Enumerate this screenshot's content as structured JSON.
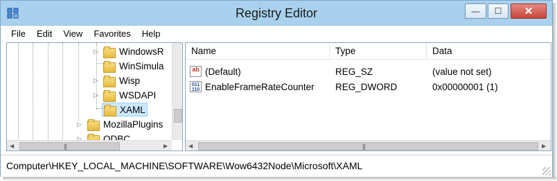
{
  "window": {
    "title": "Registry Editor",
    "icon": "registry-editor-icon",
    "controls": {
      "minimize": "—",
      "maximize": "☐",
      "close": "✕"
    }
  },
  "menu": [
    "File",
    "Edit",
    "View",
    "Favorites",
    "Help"
  ],
  "tree": {
    "items": [
      {
        "label": "WindowsR",
        "has_children": true,
        "selected": false
      },
      {
        "label": "WinSimula",
        "has_children": false,
        "selected": false
      },
      {
        "label": "Wisp",
        "has_children": true,
        "selected": false
      },
      {
        "label": "WSDAPI",
        "has_children": true,
        "selected": false
      },
      {
        "label": "XAML",
        "has_children": false,
        "selected": true
      },
      {
        "label": "MozillaPlugins",
        "has_children": true,
        "selected": false
      },
      {
        "label": "ODBC",
        "has_children": true,
        "selected": false
      }
    ]
  },
  "list": {
    "columns": [
      "Name",
      "Type",
      "Data"
    ],
    "rows": [
      {
        "icon": "string-value-icon",
        "icon_text": "ab",
        "name": "(Default)",
        "type": "REG_SZ",
        "data": "(value not set)"
      },
      {
        "icon": "dword-value-icon",
        "icon_text": "011\n110",
        "name": "EnableFrameRateCounter",
        "type": "REG_DWORD",
        "data": "0x00000001 (1)"
      }
    ]
  },
  "status": {
    "path": "Computer\\HKEY_LOCAL_MACHINE\\SOFTWARE\\Wow6432Node\\Microsoft\\XAML"
  },
  "colors": {
    "titlebar": "#a9d1ee",
    "selection": "#cce8ff",
    "close_button": "#c7463a"
  }
}
